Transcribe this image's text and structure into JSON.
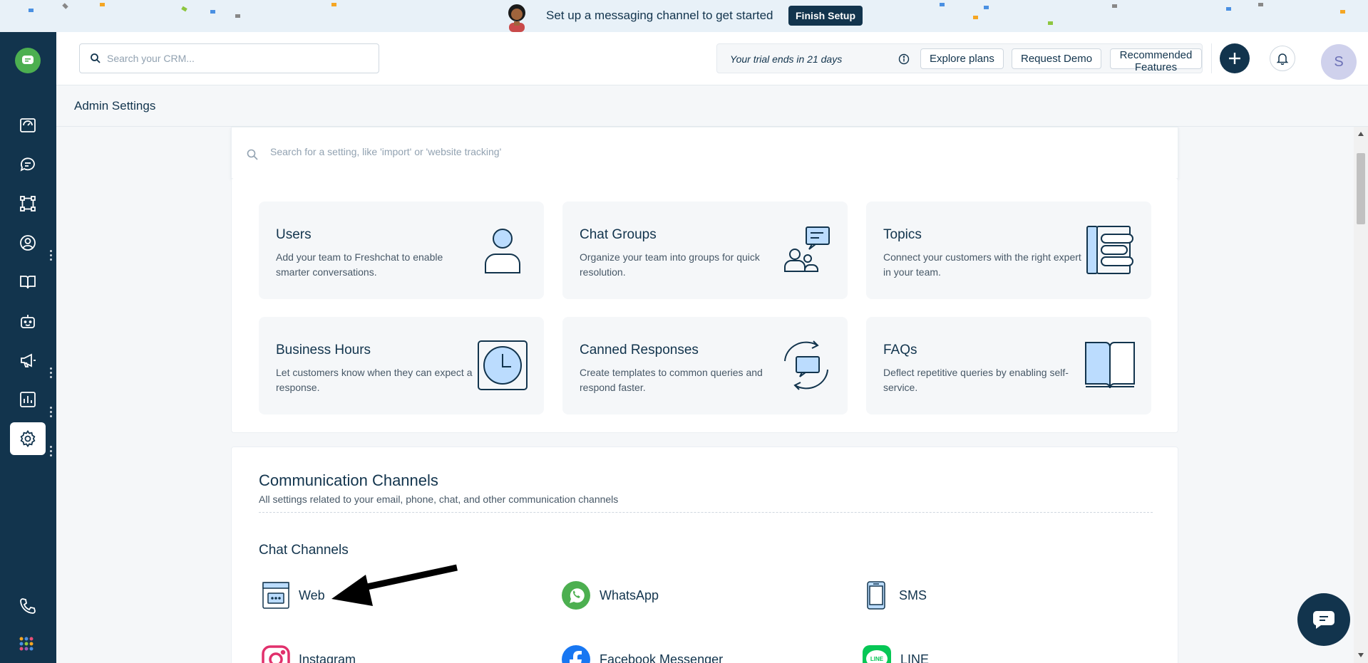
{
  "banner": {
    "message": "Set up a messaging channel to get started",
    "finish_label": "Finish Setup"
  },
  "colors": {
    "navy": "#12344d",
    "icon_fill": "#bbdcfe",
    "whatsapp": "#4caf50"
  },
  "header": {
    "search_placeholder": "Search your CRM...",
    "trial_text": "Your trial ends in 21 days",
    "explore_label": "Explore plans",
    "demo_label": "Request Demo",
    "features_label": "Recommended Features",
    "avatar_initial": "S"
  },
  "sidebar": {
    "items": [
      {
        "icon": "dashboard-icon"
      },
      {
        "icon": "conversations-icon"
      },
      {
        "icon": "workflow-icon"
      },
      {
        "icon": "contacts-icon"
      },
      {
        "icon": "knowledge-base-icon"
      },
      {
        "icon": "bot-icon"
      },
      {
        "icon": "campaigns-icon"
      },
      {
        "icon": "reports-icon"
      },
      {
        "icon": "settings-icon",
        "active": true
      },
      {
        "icon": "phone-icon"
      },
      {
        "icon": "apps-grid-icon"
      }
    ]
  },
  "page": {
    "title": "Admin Settings",
    "settings_search_placeholder": "Search for a setting, like 'import' or 'website tracking'"
  },
  "cards": [
    {
      "title": "Users",
      "desc": "Add your team to Freshchat to enable smarter conversations.",
      "icon": "user-icon"
    },
    {
      "title": "Chat Groups",
      "desc": "Organize your team into groups for quick resolution.",
      "icon": "group-chat-icon"
    },
    {
      "title": "Topics",
      "desc": "Connect your customers with the right expert in your team.",
      "icon": "topics-icon"
    },
    {
      "title": "Business Hours",
      "desc": "Let customers know when they can expect a response.",
      "icon": "clock-icon"
    },
    {
      "title": "Canned Responses",
      "desc": "Create templates to common queries and respond faster.",
      "icon": "canned-response-icon"
    },
    {
      "title": "FAQs",
      "desc": "Deflect repetitive queries by enabling self-service.",
      "icon": "book-icon"
    }
  ],
  "channels_section": {
    "title": "Communication Channels",
    "subtitle": "All settings related to your email, phone, chat, and other communication channels",
    "chat_title": "Chat Channels",
    "channels": [
      {
        "label": "Web",
        "icon": "web-widget-icon"
      },
      {
        "label": "WhatsApp",
        "icon": "whatsapp-icon"
      },
      {
        "label": "SMS",
        "icon": "sms-icon"
      },
      {
        "label": "Instagram",
        "icon": "instagram-icon"
      },
      {
        "label": "Facebook Messenger",
        "icon": "facebook-icon"
      },
      {
        "label": "LINE",
        "icon": "line-icon"
      }
    ],
    "line_badge": "LINE"
  }
}
